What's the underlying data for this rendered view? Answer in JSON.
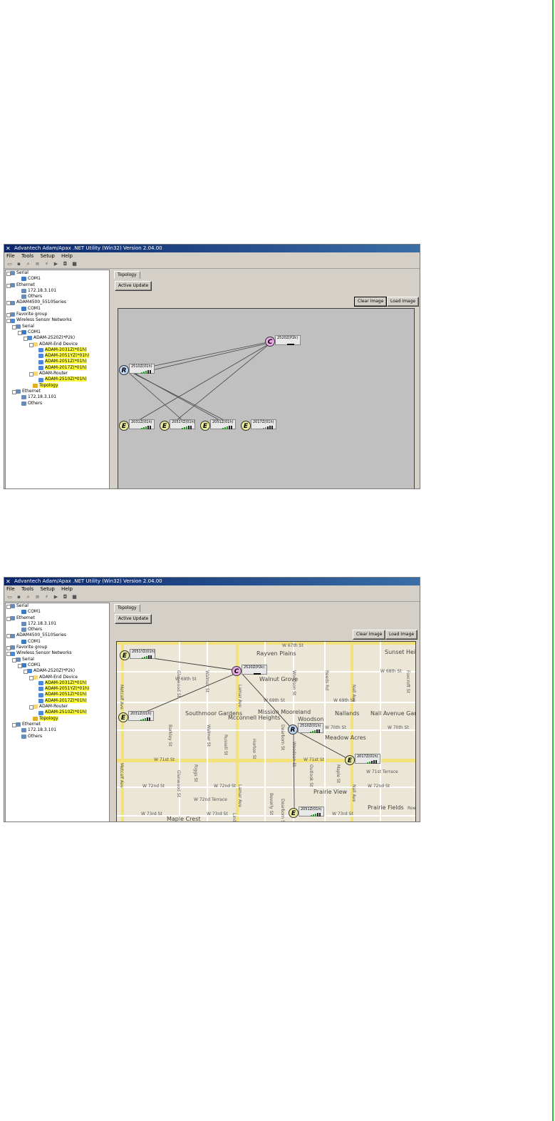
{
  "window": {
    "title": "Advantech Adam/Apax .NET Utility (Win32) Version 2.04.00",
    "menu": [
      "File",
      "Tools",
      "Setup",
      "Help"
    ]
  },
  "tree": [
    {
      "label": "Serial",
      "indent": 0,
      "icon": "serial-icon",
      "hl": false
    },
    {
      "label": "COM1",
      "indent": 2,
      "icon": "com-port-icon",
      "hl": false
    },
    {
      "label": "Ethernet",
      "indent": 0,
      "icon": "ethernet-icon",
      "hl": false
    },
    {
      "label": "172.18.3.101",
      "indent": 2,
      "icon": "network-adapter-icon",
      "hl": false
    },
    {
      "label": "Others",
      "indent": 2,
      "icon": "network-others-icon",
      "hl": false
    },
    {
      "label": "ADAM4500_5510Series",
      "indent": 0,
      "icon": "device-series-icon",
      "hl": false
    },
    {
      "label": "COM1",
      "indent": 2,
      "icon": "com-port-icon",
      "hl": false
    },
    {
      "label": "Favorite group",
      "indent": 0,
      "icon": "favorite-group-icon",
      "hl": false
    },
    {
      "label": "Wireless Sensor Networks",
      "indent": 0,
      "icon": "wireless-icon",
      "hl": false
    },
    {
      "label": "Serial",
      "indent": 1,
      "icon": "serial-icon",
      "hl": false
    },
    {
      "label": "COM1",
      "indent": 2,
      "icon": "com-port-icon",
      "hl": false
    },
    {
      "label": "ADAM-2520Z(*P2k)",
      "indent": 3,
      "icon": "wireless-device-icon",
      "hl": false
    },
    {
      "label": "ADAM-End Device",
      "indent": 4,
      "icon": "folder-icon",
      "hl": false
    },
    {
      "label": "ADAM-2031Z(*01h)",
      "indent": 5,
      "icon": "wireless-device-icon",
      "hl": true
    },
    {
      "label": "ADAM-2051YZ(*01h)",
      "indent": 5,
      "icon": "wireless-device-icon",
      "hl": true
    },
    {
      "label": "ADAM-2051Z(*01h)",
      "indent": 5,
      "icon": "wireless-device-icon",
      "hl": true
    },
    {
      "label": "ADAM-2017Z(*01h)",
      "indent": 5,
      "icon": "wireless-device-icon",
      "hl": true
    },
    {
      "label": "ADAM-Router",
      "indent": 4,
      "icon": "folder-icon",
      "hl": false
    },
    {
      "label": "ADAM-2510Z(*01h)",
      "indent": 5,
      "icon": "wireless-device-icon",
      "hl": true
    },
    {
      "label": "Topology",
      "indent": 4,
      "icon": "topology-icon",
      "hl": true
    },
    {
      "label": "Ethernet",
      "indent": 1,
      "icon": "ethernet-icon",
      "hl": false
    },
    {
      "label": "172.18.3.101",
      "indent": 2,
      "icon": "network-adapter-icon",
      "hl": false
    },
    {
      "label": "Others",
      "indent": 2,
      "icon": "network-others-icon",
      "hl": false
    }
  ],
  "panel": {
    "tab": "Topology",
    "active_update": "Active Update",
    "clear_image": "Clear Image",
    "load_image": "Load Image"
  },
  "topology1": {
    "nodes": [
      {
        "id": "C",
        "type": "C",
        "label": "2520Z(P2k)"
      },
      {
        "id": "R",
        "type": "R",
        "label": "2510Z(01h)"
      },
      {
        "id": "E1",
        "type": "E",
        "label": "2031Z(01h)"
      },
      {
        "id": "E2",
        "type": "E",
        "label": "2051YZ(01h)"
      },
      {
        "id": "E3",
        "type": "E",
        "label": "2051Z(01h)"
      },
      {
        "id": "E4",
        "type": "E",
        "label": "2017Z(01h)"
      }
    ]
  },
  "topology2": {
    "nodes": [
      {
        "id": "E1",
        "type": "E",
        "label": "2051YZ(01h)"
      },
      {
        "id": "C",
        "type": "C",
        "label": "2520Z(P2k)"
      },
      {
        "id": "E2",
        "type": "E",
        "label": "2031Z(01h)"
      },
      {
        "id": "R",
        "type": "R",
        "label": "2510Z(01h)"
      },
      {
        "id": "E3",
        "type": "E",
        "label": "2017Z(01h)"
      },
      {
        "id": "E4",
        "type": "E",
        "label": "2051Z(01h)"
      }
    ],
    "map": {
      "streets": [
        "W 67th St",
        "W 68th St",
        "W 69th St",
        "W 69th St",
        "W 69th St",
        "W 70th St",
        "W 70th St",
        "W 71st St",
        "W 71st St",
        "W 71st Terrace",
        "W 72nd St",
        "W 72nd St",
        "W 72nd St",
        "W 72nd Terrace",
        "W 73rd St",
        "W 73rd St",
        "W 73rd St",
        "Metcalf Ave",
        "Metcalf Ave",
        "Lamar Ave",
        "Lamar Ave",
        "Nall Ave",
        "Nall Ave",
        "Glenwood St",
        "Glenwood St",
        "Woodson St",
        "Woodson St",
        "Reeds Rd",
        "Foxcroft St",
        "Barkley St",
        "Walmer St",
        "Russell St",
        "Horton St",
        "Dearborn St",
        "Outlook St",
        "Maple St",
        "Beverly St",
        "Riggs St",
        "Walmer St",
        "Dearborn St",
        "Linden St",
        "Roe"
      ],
      "areas": [
        "Rayven Plains",
        "Walnut Grove",
        "Sunset Heights View",
        "Southmoor Gardens",
        "Mcconnell Heights",
        "Mission Mooreland",
        "Woodson",
        "Nallands",
        "Nall Avenue Gardens",
        "Meadow Acres",
        "Prairie View",
        "Prairie Fields",
        "Maple Crest"
      ]
    }
  }
}
